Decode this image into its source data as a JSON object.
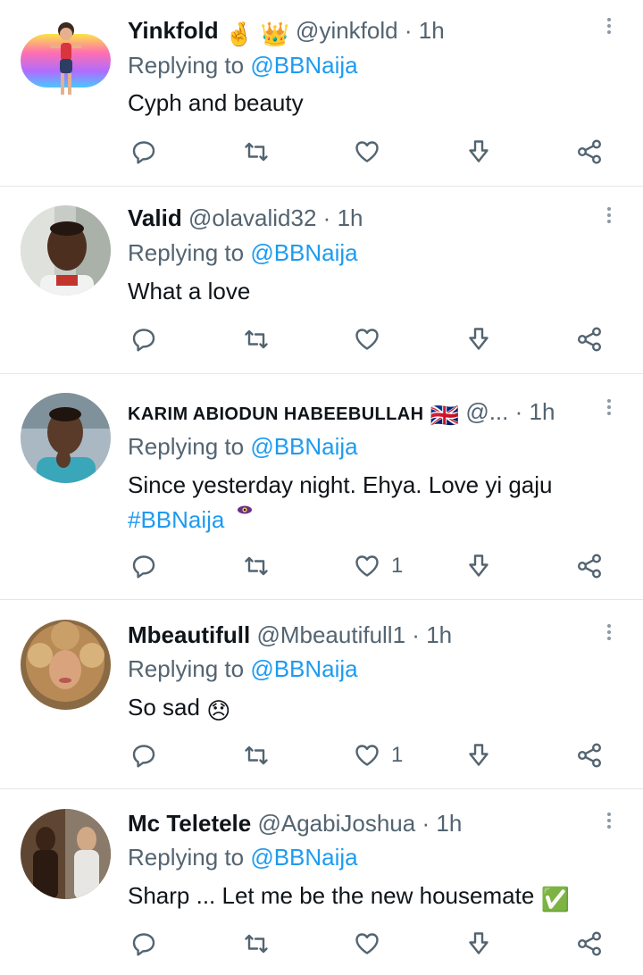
{
  "replies": [
    {
      "name": "Yinkfold",
      "badges": [
        "🤞",
        "👑"
      ],
      "handle": "@yinkfold",
      "dot": "·",
      "time": "1h",
      "replying_prefix": "Replying to",
      "replying_to": "@BBNaija",
      "text": "Cyph and beauty",
      "likes": ""
    },
    {
      "name": "Valid",
      "handle": "@olavalid32",
      "dot": "·",
      "time": "1h",
      "replying_prefix": "Replying to",
      "replying_to": "@BBNaija",
      "text": "What a love",
      "likes": ""
    },
    {
      "name": "KARIM ABIODUN HABEEBULLAH",
      "badges": [
        "🇬🇧"
      ],
      "handle": "@...",
      "dot": "·",
      "time": "1h",
      "replying_prefix": "Replying to",
      "replying_to": "@BBNaija",
      "text": "Since yesterday night. Ehya. Love yi gaju",
      "hashtag": "#BBNaija",
      "likes": "1"
    },
    {
      "name": "Mbeautifull",
      "handle": "@Mbeautifull1",
      "dot": "·",
      "time": "1h",
      "replying_prefix": "Replying to",
      "replying_to": "@BBNaija",
      "text": "So sad",
      "text_emoji": "😞",
      "likes": "1"
    },
    {
      "name": "Mc Teletele",
      "handle": "@AgabiJoshua",
      "dot": "·",
      "time": "1h",
      "replying_prefix": "Replying to",
      "replying_to": "@BBNaija",
      "text": "Sharp ... Let me be the new housemate",
      "text_emoji": "✅",
      "likes": ""
    }
  ],
  "icons": {
    "reply": "reply-icon",
    "retweet": "retweet-icon",
    "like": "heart-icon",
    "download": "download-icon",
    "share": "share-icon",
    "more": "more-vertical-icon"
  },
  "colors": {
    "link": "#1d9bf0",
    "secondary_text": "#536471",
    "icon": "#536471",
    "divider": "#e3e7ea"
  }
}
